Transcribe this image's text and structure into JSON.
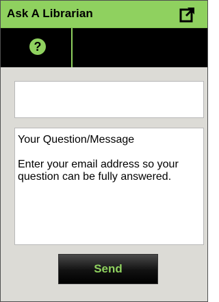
{
  "header": {
    "title": "Ask A Librarian",
    "popout_icon": "external-link-icon"
  },
  "toolbar": {
    "help_icon": "help-icon",
    "help_glyph": "?"
  },
  "form": {
    "name_value": "",
    "message_lines": [
      "Your Question/Message",
      "Enter your email address so your question can be fully answered."
    ],
    "send_label": "Send"
  },
  "colors": {
    "accent_green": "#8fd15f",
    "toolbar_black": "#000000",
    "panel_gray": "#dcdbd6"
  }
}
